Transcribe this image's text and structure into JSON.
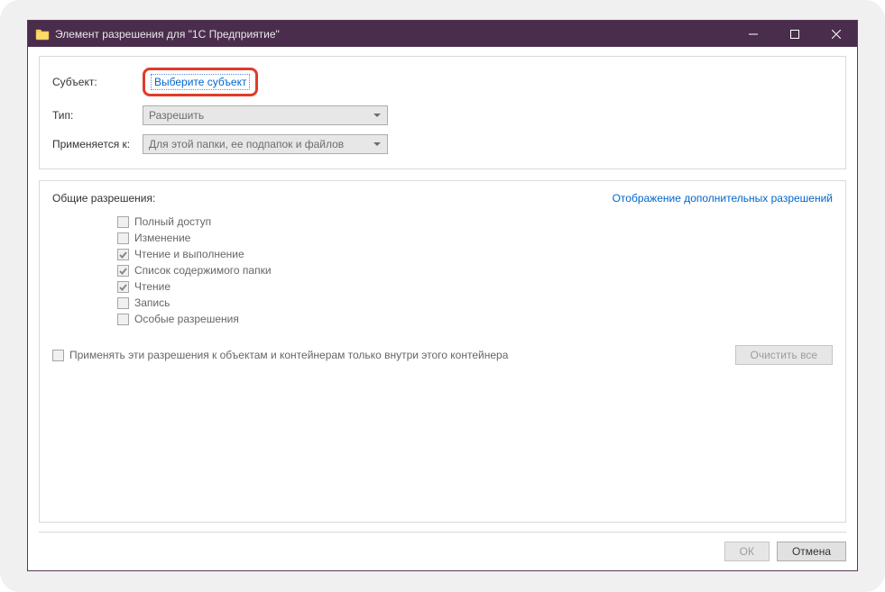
{
  "window": {
    "title": "Элемент разрешения для \"1С Предприятие\""
  },
  "top": {
    "subject_label": "Субъект:",
    "select_subject_link": "Выберите субъект",
    "type_label": "Тип:",
    "type_value": "Разрешить",
    "applies_label": "Применяется к:",
    "applies_value": "Для этой папки, ее подпапок и файлов"
  },
  "main": {
    "basic_title": "Общие разрешения:",
    "advanced_link": "Отображение дополнительных разрешений",
    "permissions": [
      {
        "label": "Полный доступ",
        "checked": false
      },
      {
        "label": "Изменение",
        "checked": false
      },
      {
        "label": "Чтение и выполнение",
        "checked": true
      },
      {
        "label": "Список содержимого папки",
        "checked": true
      },
      {
        "label": "Чтение",
        "checked": true
      },
      {
        "label": "Запись",
        "checked": false
      },
      {
        "label": "Особые разрешения",
        "checked": false
      }
    ],
    "apply_only_label": "Применять эти разрешения к объектам и контейнерам только внутри этого контейнера",
    "clear_all": "Очистить все"
  },
  "footer": {
    "ok": "ОК",
    "cancel": "Отмена"
  }
}
